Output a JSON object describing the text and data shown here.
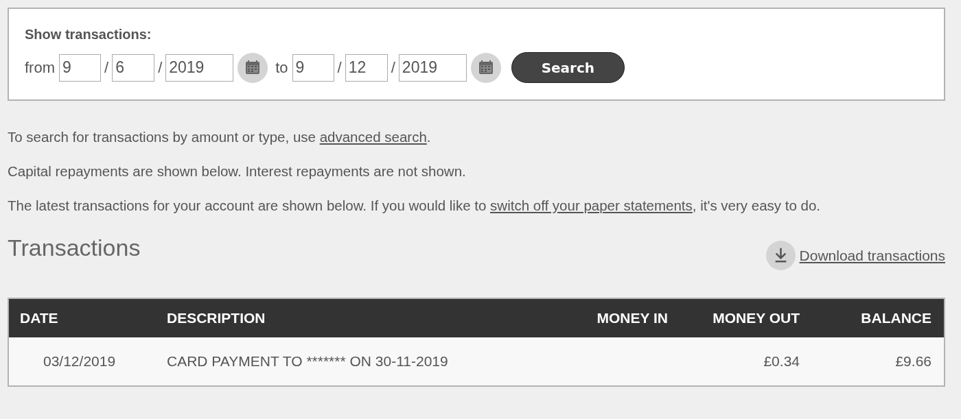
{
  "filter": {
    "title": "Show transactions:",
    "from_label": "from",
    "to_label": "to",
    "separator": "/",
    "from_date": {
      "day": "9",
      "month": "6",
      "year": "2019"
    },
    "to_date": {
      "day": "9",
      "month": "12",
      "year": "2019"
    },
    "search_button": "Search"
  },
  "paragraphs": [
    [
      {
        "kind": "text",
        "text": "To search for transactions by amount or type, use "
      },
      {
        "kind": "link",
        "text": "advanced search"
      },
      {
        "kind": "text",
        "text": "."
      }
    ],
    [
      {
        "kind": "text",
        "text": "Capital repayments are shown below. Interest repayments are not shown."
      }
    ],
    [
      {
        "kind": "text",
        "text": "The latest transactions for your account are shown below. If you would like to "
      },
      {
        "kind": "link",
        "text": "switch off your paper statements"
      },
      {
        "kind": "text",
        "text": ", it's very easy to do."
      }
    ]
  ],
  "transactions": {
    "heading": "Transactions",
    "download_link": "Download transactions",
    "columns": [
      "DATE",
      "DESCRIPTION",
      "MONEY IN",
      "MONEY OUT",
      "BALANCE"
    ],
    "rows": [
      {
        "date": "03/12/2019",
        "description": "CARD PAYMENT TO ******* ON 30-11-2019",
        "money_out": "£0.34",
        "balance": "£9.66"
      }
    ]
  }
}
